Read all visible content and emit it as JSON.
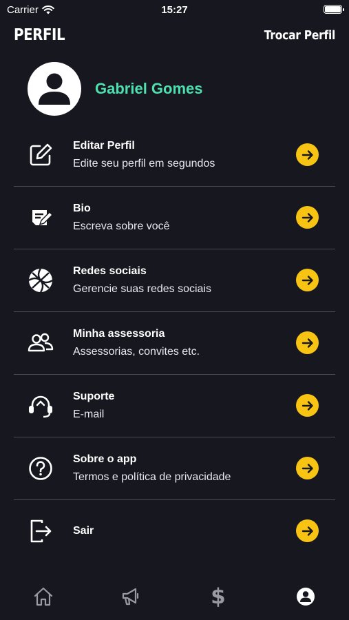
{
  "status_bar": {
    "carrier": "Carrier",
    "time": "15:27"
  },
  "header": {
    "title": "PERFIL",
    "action_label": "Trocar Perfil"
  },
  "profile": {
    "name": "Gabriel Gomes",
    "name_color": "#4fe0b0"
  },
  "menu": {
    "items": [
      {
        "title": "Editar Perfil",
        "subtitle": "Edite seu perfil em segundos",
        "icon": "edit-icon"
      },
      {
        "title": "Bio",
        "subtitle": "Escreva sobre você",
        "icon": "bio-icon"
      },
      {
        "title": "Redes sociais",
        "subtitle": "Gerencie suas redes sociais",
        "icon": "basketball-icon"
      },
      {
        "title": "Minha assessoria",
        "subtitle": "Assessorias, convites etc.",
        "icon": "users-icon"
      },
      {
        "title": "Suporte",
        "subtitle": "E-mail",
        "icon": "headset-icon"
      },
      {
        "title": "Sobre o app",
        "subtitle": "Termos e política de privacidade",
        "icon": "question-icon"
      },
      {
        "title": "Sair",
        "icon": "logout-icon"
      }
    ]
  },
  "tab_bar": {
    "tabs": [
      {
        "icon": "home-icon",
        "active": false
      },
      {
        "icon": "megaphone-icon",
        "active": false
      },
      {
        "icon": "dollar-icon",
        "label": "$",
        "active": false
      },
      {
        "icon": "profile-icon",
        "active": true
      }
    ]
  },
  "colors": {
    "background": "#17171f",
    "accent": "#f7c413",
    "divider": "#4a4a55",
    "inactive_tab": "#9a9aa5"
  }
}
